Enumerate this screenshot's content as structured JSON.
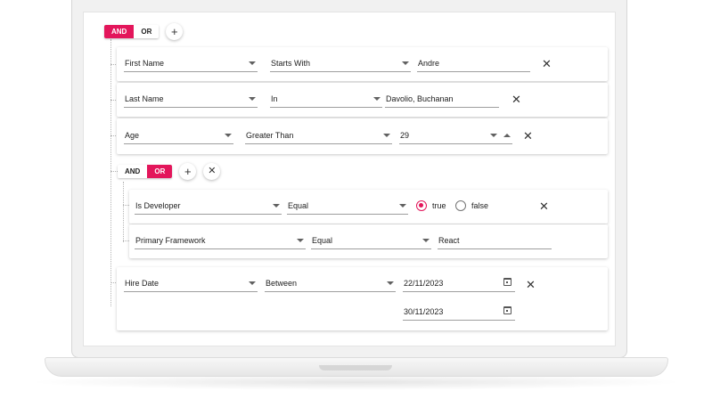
{
  "root_group": {
    "and_label": "AND",
    "or_label": "OR",
    "active": "AND",
    "add_icon": "plus-icon"
  },
  "rules": [
    {
      "field": "First Name",
      "operator": "Starts With",
      "value": "Andre"
    },
    {
      "field": "Last Name",
      "operator": "In",
      "value": "Davolio, Buchanan"
    },
    {
      "field": "Age",
      "operator": "Greater Than",
      "value": "29"
    }
  ],
  "sub_group": {
    "and_label": "AND",
    "or_label": "OR",
    "active": "OR",
    "add_icon": "plus-icon",
    "remove_icon": "close-icon",
    "rules": [
      {
        "field": "Is Developer",
        "operator": "Equal",
        "option_true": "true",
        "option_false": "false",
        "selected": "true"
      },
      {
        "field": "Primary Framework",
        "operator": "Equal",
        "value": "React"
      }
    ]
  },
  "date_rule": {
    "field": "Hire Date",
    "operator": "Between",
    "start": "22/11/2023",
    "end": "30/11/2023"
  },
  "colors": {
    "accent": "#e3165b"
  }
}
